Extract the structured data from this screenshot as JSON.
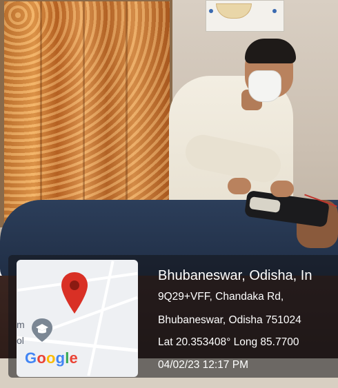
{
  "location": {
    "title": "Bhubaneswar, Odisha, In",
    "address_line1": "9Q29+VFF, Chandaka Rd,",
    "address_line2": "Bhubaneswar, Odisha 751024",
    "coordinates": "Lat 20.353408° Long 85.7700",
    "datetime": "04/02/23 12:17 PM"
  },
  "map": {
    "edge_text_top": "m",
    "edge_text_bottom": "ol",
    "logo": [
      "G",
      "o",
      "o",
      "g",
      "l",
      "e"
    ],
    "pin_color": "#d93025",
    "marker_icon": "school-icon"
  },
  "colors": {
    "overlay": "rgba(20,20,24,0.55)",
    "google_blue": "#4285f4",
    "google_red": "#ea4335",
    "google_yellow": "#fbbc05",
    "google_green": "#34a853"
  }
}
